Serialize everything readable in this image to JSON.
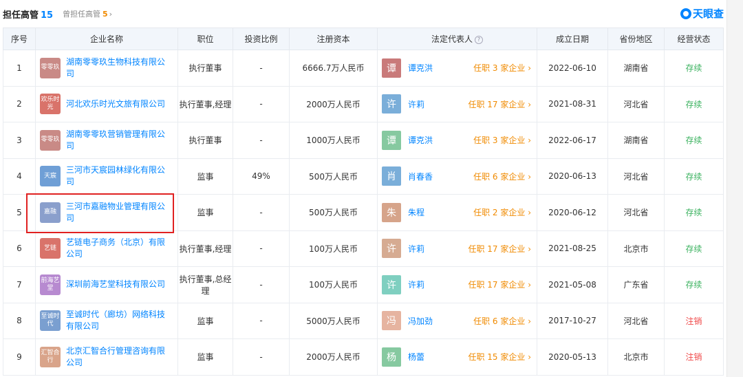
{
  "header": {
    "title": "担任高管",
    "count": "15",
    "former_label": "曾担任高管",
    "former_count": "5",
    "former_arrow": "›",
    "brand": "天眼查",
    "brand_icon": "tianyancha-logo-icon"
  },
  "columns": [
    "序号",
    "企业名称",
    "职位",
    "投资比例",
    "注册资本",
    "法定代表人",
    "成立日期",
    "省份地区",
    "经营状态"
  ],
  "help_icon": "?",
  "colors": {
    "accent": "#0084ff",
    "tenure": "#f08a00",
    "status_live": "#3bb25f",
    "status_cancel": "#f04848",
    "highlight_border": "#e02020"
  },
  "rows": [
    {
      "no": "1",
      "logo_text": "零零玖",
      "logo_color": "#c98a86",
      "company": "湖南零零玖生物科技有限公司",
      "position": "执行董事",
      "ratio": "-",
      "capital": "6666.7万人民币",
      "rep_char": "谭",
      "rep_color": "#c97a7a",
      "rep_name": "谭克洪",
      "rep_tenure": "任职 3 家企业 ›",
      "date": "2022-06-10",
      "region": "湖南省",
      "status": "存续",
      "status_type": "live"
    },
    {
      "no": "2",
      "logo_text": "欢乐时光",
      "logo_color": "#d9736a",
      "company": "河北欢乐时光文旅有限公司",
      "position": "执行董事,经理",
      "ratio": "-",
      "capital": "2000万人民币",
      "rep_char": "许",
      "rep_color": "#7aaed9",
      "rep_name": "许莉",
      "rep_tenure": "任职 17 家企业 ›",
      "date": "2021-08-31",
      "region": "河北省",
      "status": "存续",
      "status_type": "live"
    },
    {
      "no": "3",
      "logo_text": "零零玖",
      "logo_color": "#c98a86",
      "company": "湖南零零玖营销管理有限公司",
      "position": "执行董事",
      "ratio": "-",
      "capital": "1000万人民币",
      "rep_char": "谭",
      "rep_color": "#86c9a0",
      "rep_name": "谭克洪",
      "rep_tenure": "任职 3 家企业 ›",
      "date": "2022-06-17",
      "region": "湖南省",
      "status": "存续",
      "status_type": "live"
    },
    {
      "no": "4",
      "logo_text": "天宸",
      "logo_color": "#6f9fd6",
      "company": "三河市天宸园林绿化有限公司",
      "position": "监事",
      "ratio": "49%",
      "capital": "500万人民币",
      "rep_char": "肖",
      "rep_color": "#7aaed9",
      "rep_name": "肖春香",
      "rep_tenure": "任职 6 家企业 ›",
      "date": "2020-06-13",
      "region": "河北省",
      "status": "存续",
      "status_type": "live"
    },
    {
      "no": "5",
      "logo_text": "嘉融",
      "logo_color": "#8a9fcc",
      "company": "三河市嘉融物业管理有限公司",
      "position": "监事",
      "ratio": "-",
      "capital": "500万人民币",
      "rep_char": "朱",
      "rep_color": "#d6a48a",
      "rep_name": "朱程",
      "rep_tenure": "任职 2 家企业 ›",
      "date": "2020-06-12",
      "region": "河北省",
      "status": "存续",
      "status_type": "live"
    },
    {
      "no": "6",
      "logo_text": "艺链",
      "logo_color": "#d9736a",
      "company": "艺链电子商务（北京）有限公司",
      "position": "执行董事,经理",
      "ratio": "-",
      "capital": "100万人民币",
      "rep_char": "许",
      "rep_color": "#d6ab92",
      "rep_name": "许莉",
      "rep_tenure": "任职 17 家企业 ›",
      "date": "2021-08-25",
      "region": "北京市",
      "status": "存续",
      "status_type": "live"
    },
    {
      "no": "7",
      "logo_text": "前海艺堂",
      "logo_color": "#b78ad0",
      "company": "深圳前海艺堂科技有限公司",
      "position": "执行董事,总经理",
      "ratio": "-",
      "capital": "100万人民币",
      "rep_char": "许",
      "rep_color": "#7fcfc0",
      "rep_name": "许莉",
      "rep_tenure": "任职 17 家企业 ›",
      "date": "2021-05-08",
      "region": "广东省",
      "status": "存续",
      "status_type": "live"
    },
    {
      "no": "8",
      "logo_text": "至诚时代",
      "logo_color": "#7a9fd0",
      "company": "至诚时代（廊坊）网络科技有限公司",
      "position": "监事",
      "ratio": "-",
      "capital": "5000万人民币",
      "rep_char": "冯",
      "rep_color": "#e6b4a0",
      "rep_name": "冯加劲",
      "rep_tenure": "任职 6 家企业 ›",
      "date": "2017-10-27",
      "region": "河北省",
      "status": "注销",
      "status_type": "cancel"
    },
    {
      "no": "9",
      "logo_text": "汇智合行",
      "logo_color": "#d9a48a",
      "company": "北京汇智合行管理咨询有限公司",
      "position": "监事",
      "ratio": "-",
      "capital": "2000万人民币",
      "rep_char": "杨",
      "rep_color": "#86c9a0",
      "rep_name": "杨蕾",
      "rep_tenure": "任职 15 家企业 ›",
      "date": "2020-05-13",
      "region": "北京市",
      "status": "注销",
      "status_type": "cancel"
    }
  ]
}
